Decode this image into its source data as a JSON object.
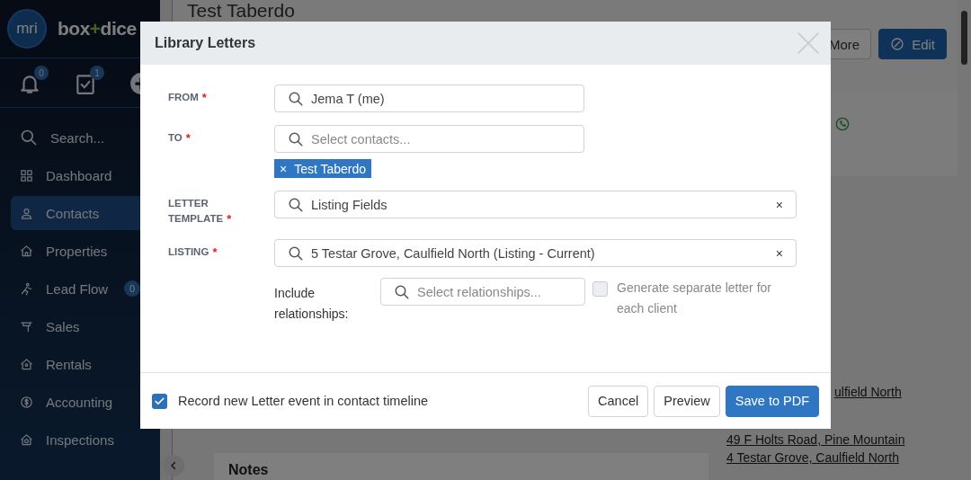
{
  "sidebar": {
    "logo": {
      "badge": "mri",
      "brand_left": "box",
      "brand_plus": "+",
      "brand_right": "dice"
    },
    "quick_actions": [
      {
        "count": "0"
      },
      {
        "count": "1"
      }
    ],
    "search": {
      "label": "Search..."
    },
    "items": [
      {
        "label": "Dashboard",
        "selected": false
      },
      {
        "label": "Contacts",
        "selected": true
      },
      {
        "label": "Properties",
        "selected": false
      },
      {
        "label": "Lead Flow",
        "selected": false,
        "badge": "0"
      },
      {
        "label": "Sales",
        "selected": false
      },
      {
        "label": "Rentals",
        "selected": false
      },
      {
        "label": "Accounting",
        "selected": false
      },
      {
        "label": "Inspections",
        "selected": false
      }
    ]
  },
  "page": {
    "title": "Test Taberdo",
    "actions": [
      {
        "label": "More",
        "kind": "default"
      },
      {
        "label": "Edit",
        "kind": "primary"
      }
    ],
    "links": [
      "ulfield North",
      "49 F Holts Road, Pine Mountain",
      "4 Testar Grove, Caulfield North"
    ],
    "notes_heading": "Notes"
  },
  "modal": {
    "title": "Library Letters",
    "fields": [
      {
        "label": "FROM",
        "mark": "*",
        "value": "Jema T (me)",
        "wide": false
      },
      {
        "label": "TO",
        "mark": "*",
        "placeholder": "Select contacts...",
        "wide": false,
        "tags": [
          {
            "remove": "×",
            "label": "Test Taberdo"
          }
        ]
      },
      {
        "label": "LETTER TEMPLATE",
        "mark": "*",
        "value": "Listing Fields",
        "wide": true,
        "clear": "×"
      },
      {
        "label": "LISTING",
        "mark": "*",
        "value": "5 Testar Grove, Caulfield North (Listing - Current)",
        "wide": true,
        "clear": "×"
      }
    ],
    "relationships": {
      "label": "Include relationships:",
      "placeholder": "Select relationships...",
      "separate": {
        "label": "Generate separate letter for each client",
        "checked": false,
        "disabled": true
      }
    },
    "record": {
      "label": "Record new Letter event in contact timeline",
      "checked": true
    },
    "buttons": [
      {
        "label": "Cancel",
        "kind": "default"
      },
      {
        "label": "Preview",
        "kind": "default"
      },
      {
        "label": "Save to PDF",
        "kind": "primary"
      }
    ]
  }
}
